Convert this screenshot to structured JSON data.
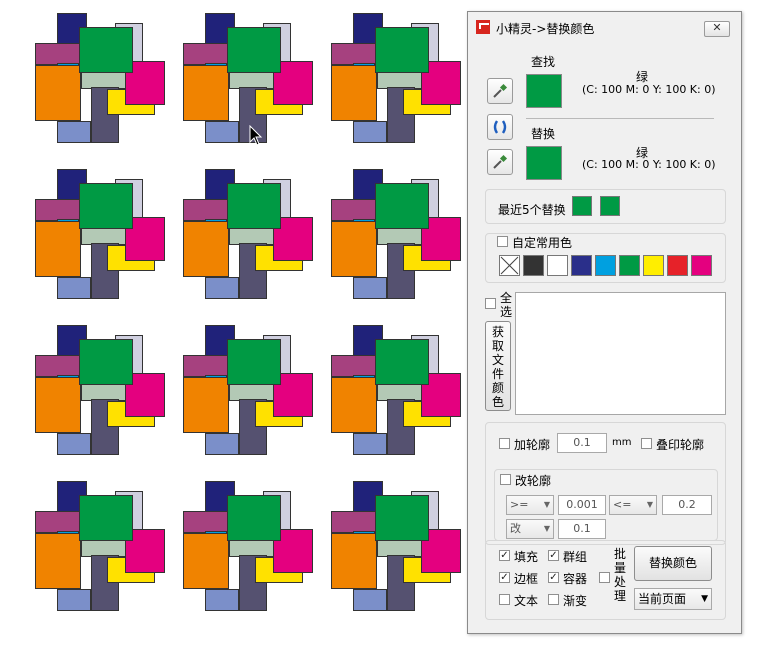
{
  "panel": {
    "title": "小精灵->替换颜色",
    "close_label": "✕",
    "find": {
      "label": "查找",
      "color_name": "绿",
      "cmyk": "(C: 100 M: 0 Y: 100 K: 0)",
      "swatch_color": "#009a44"
    },
    "replace": {
      "label": "替换",
      "color_name": "绿",
      "cmyk": "(C: 100 M: 0 Y: 100 K: 0)",
      "swatch_color": "#009a44"
    },
    "recent": {
      "label": "最近5个替换",
      "swatches": [
        "#009a44",
        "#009a44"
      ]
    },
    "custom": {
      "label": "自定常用色",
      "palette": [
        "none",
        "#333333",
        "#ffffff",
        "#2a2f8a",
        "#00a0e0",
        "#009a44",
        "#ffee00",
        "#e62229",
        "#e4007f"
      ]
    },
    "select_all_label": "全选",
    "get_colors_label": "获取文件颜色",
    "outline": {
      "add_label": "加轮廓",
      "add_value": "0.1",
      "unit": "mm",
      "overprint_label": "叠印轮廓",
      "change_label": "改轮廓",
      "cond1": ">=",
      "val1": "0.001",
      "cond2": "<=",
      "val2": "0.2",
      "action": "改",
      "val3": "0.1"
    },
    "options": {
      "fill": "填充",
      "group": "群组",
      "border": "边框",
      "container": "容器",
      "text": "文本",
      "gradient": "渐变"
    },
    "batch_label": "批量处理",
    "replace_button": "替换颜色",
    "scope": "当前页面"
  },
  "colors": {
    "navy": "#20227a",
    "purple": "#a6417f",
    "lavender": "#d0d0e0",
    "cyan": "#009fe0",
    "green": "#009a44",
    "magenta": "#e4007f",
    "orange": "#f08300",
    "sage": "#b3c9b5",
    "yellow": "#ffe100",
    "slate": "#555170",
    "periwinkle": "#7b8fc9"
  }
}
